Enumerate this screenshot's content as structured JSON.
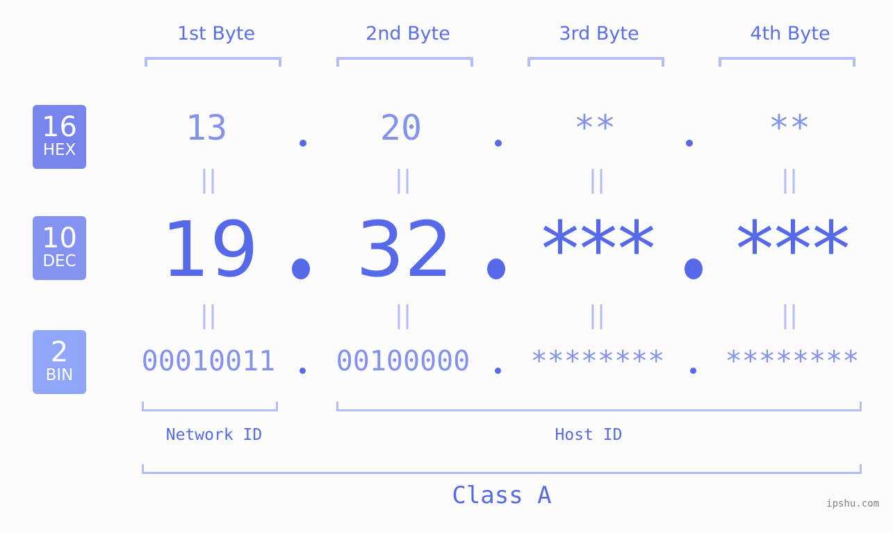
{
  "bytes": [
    {
      "header": "1st Byte",
      "hex": "13",
      "dec": "19",
      "bin": "00010011"
    },
    {
      "header": "2nd Byte",
      "hex": "20",
      "dec": "32",
      "bin": "00100000"
    },
    {
      "header": "3rd Byte",
      "hex": "**",
      "dec": "***",
      "bin": "********"
    },
    {
      "header": "4th Byte",
      "hex": "**",
      "dec": "***",
      "bin": "********"
    }
  ],
  "bases": [
    {
      "num": "16",
      "label": "HEX",
      "color": "#7684ec"
    },
    {
      "num": "10",
      "label": "DEC",
      "color": "#8593f0"
    },
    {
      "num": "2",
      "label": "BIN",
      "color": "#90a6f8"
    }
  ],
  "equals_symbol": "||",
  "network_label": "Network ID",
  "host_label": "Host ID",
  "class_label": "Class A",
  "watermark": "ipshu.com",
  "colors": {
    "primary": "#566ae9",
    "secondary": "#8592ea",
    "bracket": "#b4bdf6",
    "background": "#fbfcfb"
  }
}
